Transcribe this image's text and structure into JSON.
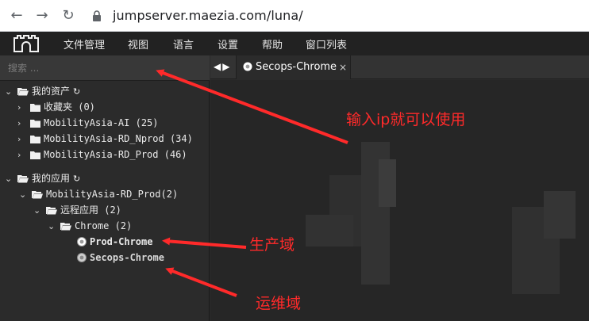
{
  "browser": {
    "url": "jumpserver.maezia.com/luna/",
    "back_icon": "back-arrow-icon",
    "forward_icon": "forward-arrow-icon",
    "reload_icon": "reload-icon",
    "lock_icon": "lock-icon"
  },
  "menubar": {
    "logo_icon": "jumpserver-logo-icon",
    "items": [
      "文件管理",
      "视图",
      "语言",
      "设置",
      "帮助",
      "窗口列表"
    ]
  },
  "sidebar": {
    "search_placeholder": "搜索 ...",
    "tree": [
      {
        "label": "我的资产",
        "expanded": true,
        "type": "root"
      },
      {
        "label": "收藏夹 (0)",
        "expanded": false,
        "type": "folder"
      },
      {
        "label": "MobilityAsia-AI (25)",
        "expanded": false,
        "type": "folder"
      },
      {
        "label": "MobilityAsia-RD_Nprod (34)",
        "expanded": false,
        "type": "folder"
      },
      {
        "label": "MobilityAsia-RD_Prod (46)",
        "expanded": false,
        "type": "folder"
      },
      {
        "label": "我的应用",
        "expanded": true,
        "type": "root"
      },
      {
        "label": "MobilityAsia-RD_Prod(2)",
        "expanded": true,
        "type": "folder"
      },
      {
        "label": "远程应用 (2)",
        "expanded": true,
        "type": "folder"
      },
      {
        "label": "Chrome (2)",
        "expanded": true,
        "type": "folder"
      },
      {
        "label": "Prod-Chrome",
        "type": "app"
      },
      {
        "label": "Secops-Chrome",
        "type": "app"
      }
    ]
  },
  "tabs": [
    {
      "label": "Secops-Chrome",
      "icon": "chrome-icon",
      "close": "×",
      "active": true
    }
  ],
  "annotations": {
    "search_hint": "输入ip就可以使用",
    "prod_label": "生产域",
    "ops_label": "运维域",
    "color": "#ff2a2a"
  },
  "colors": {
    "menubar_bg": "#222222",
    "sidebar_bg": "#2b2b2b",
    "viewport_bg": "#262626",
    "annotation": "#ff2a2a"
  }
}
